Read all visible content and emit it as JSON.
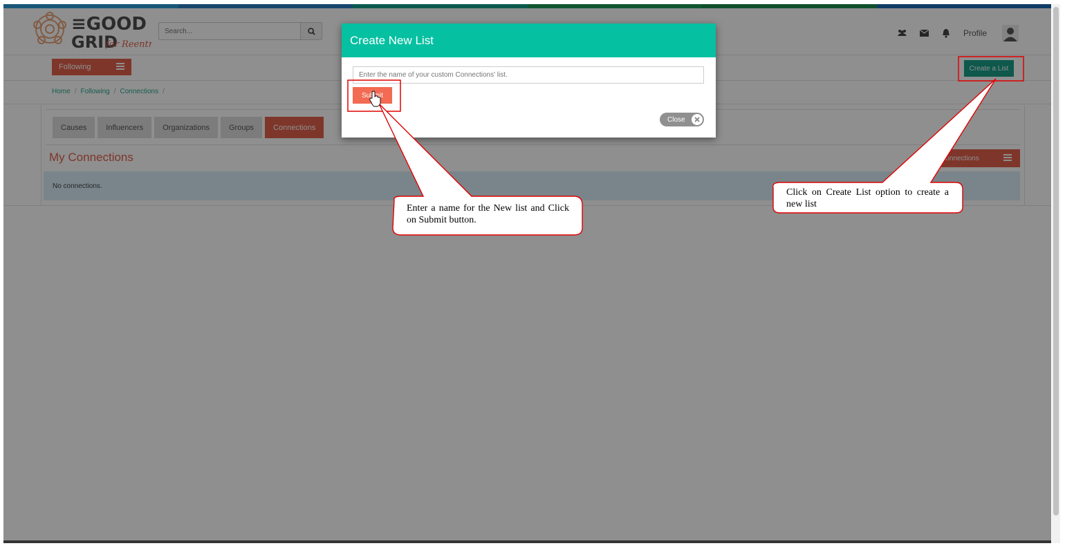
{
  "colors": {
    "accent_orange": "#e0604b",
    "accent_teal": "#1a9d88",
    "modal_header_teal": "#06c0a2",
    "annotation_red": "#e00000"
  },
  "stripe_colors": [
    "#2d9bd6",
    "#2a7fc2",
    "#17a089",
    "#1e9b58",
    "#1a8f4e",
    "#1b6bb3"
  ],
  "header": {
    "search": {
      "placeholder": "Search...",
      "icon": "search-icon"
    },
    "icons": [
      "group-icon",
      "envelope-icon",
      "bell-icon"
    ],
    "profile_label": "Profile",
    "avatar_icon": "user-icon"
  },
  "subbar": {
    "following_label": "Following",
    "create_list_label": "Create a List"
  },
  "breadcrumb": [
    "Home",
    "Following",
    "Connections"
  ],
  "tabs": [
    {
      "label": "Causes",
      "active": false
    },
    {
      "label": "Influencers",
      "active": false
    },
    {
      "label": "Organizations",
      "active": false
    },
    {
      "label": "Groups",
      "active": false
    },
    {
      "label": "Connections",
      "active": true
    }
  ],
  "section": {
    "title": "My Connections",
    "dropdown_label": "My Connections",
    "empty_message": "No connections."
  },
  "modal": {
    "title": "Create New List",
    "input_placeholder": "Enter the name of your custom Connections' list.",
    "submit_label": "Submit",
    "close_label": "Close"
  },
  "annotations": {
    "submit_callout": "Enter a name for the New list and Click on Submit button.",
    "create_callout": "Click on Create List option to create a new list"
  }
}
